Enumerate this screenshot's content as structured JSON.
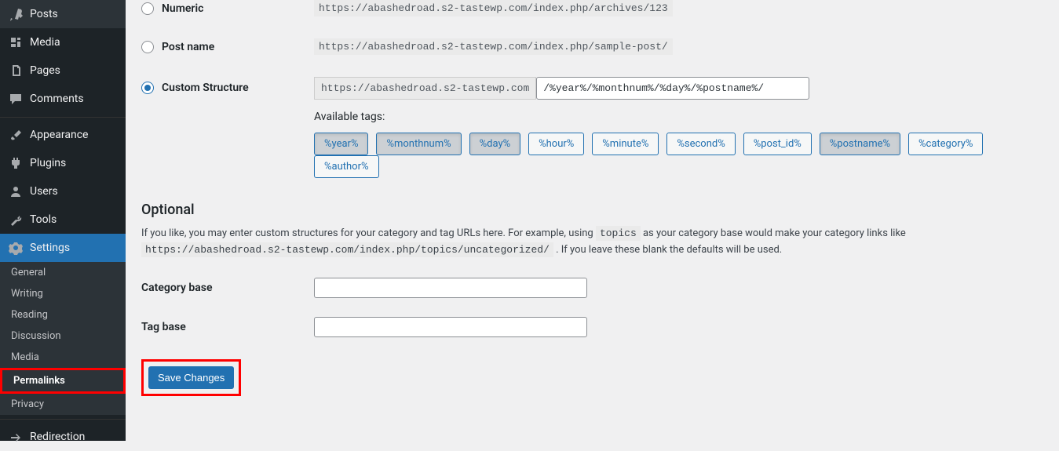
{
  "sidebar": {
    "items": [
      {
        "label": "Posts"
      },
      {
        "label": "Media"
      },
      {
        "label": "Pages"
      },
      {
        "label": "Comments"
      },
      {
        "label": "Appearance"
      },
      {
        "label": "Plugins"
      },
      {
        "label": "Users"
      },
      {
        "label": "Tools"
      },
      {
        "label": "Settings"
      },
      {
        "label": "Redirection"
      }
    ],
    "submenu": [
      {
        "label": "General"
      },
      {
        "label": "Writing"
      },
      {
        "label": "Reading"
      },
      {
        "label": "Discussion"
      },
      {
        "label": "Media"
      },
      {
        "label": "Permalinks"
      },
      {
        "label": "Privacy"
      }
    ]
  },
  "form": {
    "numeric_label": "Numeric",
    "numeric_example": "https://abashedroad.s2-tastewp.com/index.php/archives/123",
    "postname_label": "Post name",
    "postname_example": "https://abashedroad.s2-tastewp.com/index.php/sample-post/",
    "custom_label": "Custom Structure",
    "custom_prefix": "https://abashedroad.s2-tastewp.com",
    "custom_value": "/%year%/%monthnum%/%day%/%postname%/",
    "available_tags_label": "Available tags:",
    "tags": [
      "%year%",
      "%monthnum%",
      "%day%",
      "%hour%",
      "%minute%",
      "%second%",
      "%post_id%",
      "%postname%",
      "%category%",
      "%author%"
    ]
  },
  "optional": {
    "heading": "Optional",
    "desc_prefix": "If you like, you may enter custom structures for your category and tag URLs here. For example, using ",
    "desc_code1": "topics",
    "desc_mid": " as your category base would make your category links like ",
    "desc_code2": "https://abashedroad.s2-tastewp.com/index.php/topics/uncategorized/",
    "desc_suffix": " . If you leave these blank the defaults will be used.",
    "category_label": "Category base",
    "category_value": "",
    "tag_label": "Tag base",
    "tag_value": ""
  },
  "save_label": "Save Changes"
}
